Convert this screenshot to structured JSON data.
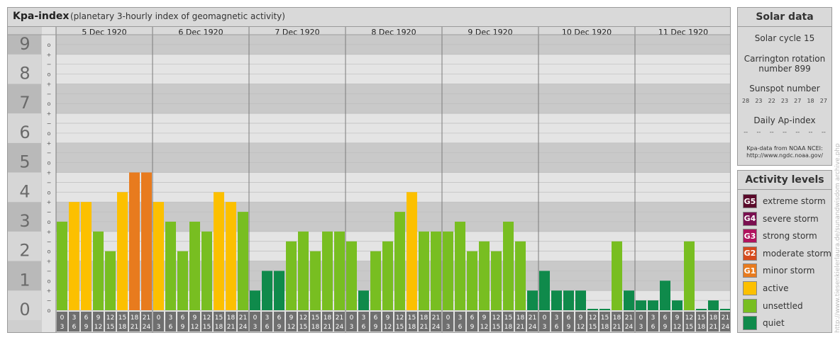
{
  "header": {
    "title": "Kpa-index",
    "subtitle": "(planetary 3-hourly index of geomagnetic activity)"
  },
  "chart_data": {
    "type": "bar",
    "y_levels": [
      "0",
      "1",
      "2",
      "3",
      "4",
      "5",
      "6",
      "7",
      "8",
      "9"
    ],
    "y_sub_marks": [
      "+",
      "o",
      "−"
    ],
    "ylim": [
      0,
      9
    ],
    "days": [
      "5 Dec 1920",
      "6 Dec 1920",
      "7 Dec 1920",
      "8 Dec 1920",
      "9 Dec 1920",
      "10 Dec 1920",
      "11 Dec 1920"
    ],
    "interval_start": [
      "0",
      "3",
      "6",
      "9",
      "12",
      "15",
      "18",
      "21"
    ],
    "interval_end": [
      "3",
      "6",
      "9",
      "12",
      "15",
      "18",
      "21",
      "24"
    ],
    "values": [
      3.0,
      3.667,
      3.667,
      2.667,
      2.0,
      4.0,
      4.667,
      4.667,
      3.667,
      3.0,
      2.0,
      3.0,
      2.667,
      4.0,
      3.667,
      3.333,
      0.667,
      1.333,
      1.333,
      2.333,
      2.667,
      2.0,
      2.667,
      2.667,
      2.333,
      0.667,
      2.0,
      2.333,
      3.333,
      4.0,
      2.667,
      2.667,
      2.667,
      3.0,
      2.0,
      2.333,
      2.0,
      3.0,
      2.333,
      0.667,
      1.333,
      0.667,
      0.667,
      0.667,
      0.0,
      0.0,
      2.333,
      0.667,
      0.333,
      0.333,
      1.0,
      0.333,
      2.333,
      0.0,
      0.333,
      0.0
    ],
    "colors": {
      "quiet": "#0f8a4b",
      "unsettled": "#78be21",
      "active": "#fcc000",
      "minor": "#e87b1e"
    }
  },
  "solar": {
    "title": "Solar data",
    "cycle": "Solar cycle 15",
    "carrington_line1": "Carrington rotation",
    "carrington_line2": "number 899",
    "sunspot_label": "Sunspot number",
    "sunspot_values": [
      "28",
      "23",
      "22",
      "23",
      "27",
      "18",
      "27"
    ],
    "ap_label": "Daily Ap-index",
    "ap_values": [
      "--",
      "--",
      "--",
      "--",
      "--",
      "--",
      "--"
    ],
    "credit_line1": "Kpa-data from NOAA NCEI:",
    "credit_line2": "http://www.ngdc.noaa.gov/"
  },
  "activity": {
    "title": "Activity levels",
    "items": [
      {
        "badge": "G5",
        "label": "extreme storm",
        "color": "#5a0a2a"
      },
      {
        "badge": "G4",
        "label": "severe storm",
        "color": "#7a1050"
      },
      {
        "badge": "G3",
        "label": "strong storm",
        "color": "#b0135e"
      },
      {
        "badge": "G2",
        "label": "moderate storm",
        "color": "#d64a1c"
      },
      {
        "badge": "G1",
        "label": "minor storm",
        "color": "#e87b1e"
      },
      {
        "badge": "",
        "label": "active",
        "color": "#fcc000"
      },
      {
        "badge": "",
        "label": "unsettled",
        "color": "#78be21"
      },
      {
        "badge": "",
        "label": "quiet",
        "color": "#0f8a4b"
      }
    ]
  },
  "watermark": "http://www.tiesenkielerlaura.de/sunandwisdom archive.php"
}
